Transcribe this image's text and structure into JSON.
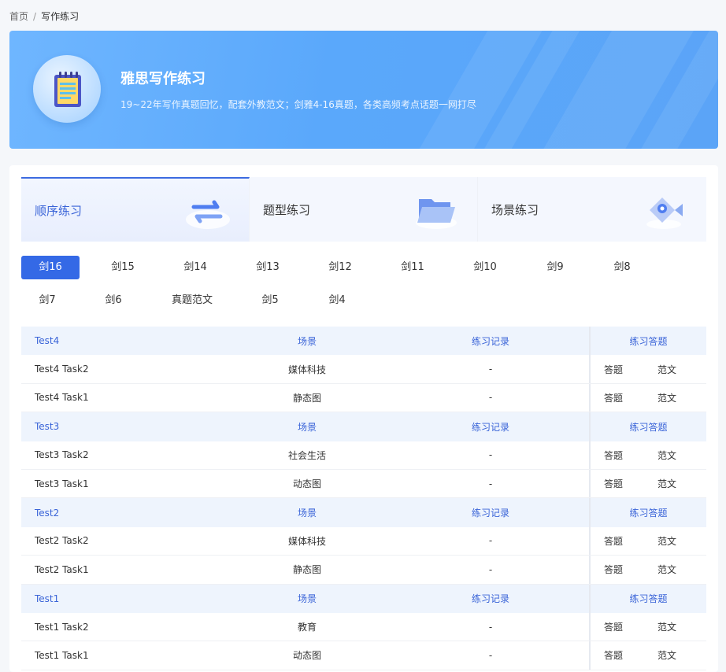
{
  "breadcrumb": {
    "home": "首页",
    "separator": "/",
    "current": "写作练习"
  },
  "banner": {
    "title": "雅思写作练习",
    "subtitle": "19~22年写作真题回忆，配套外教范文；剑雅4-16真题，各类高频考点话题一网打尽",
    "icon": "notepad-icon"
  },
  "mode_tabs": [
    {
      "label": "顺序练习",
      "icon": "swap-arrows-icon",
      "active": true
    },
    {
      "label": "题型练习",
      "icon": "folder-icon",
      "active": false
    },
    {
      "label": "场景练习",
      "icon": "location-fish-icon",
      "active": false
    }
  ],
  "book_tabs": [
    "剑16",
    "剑15",
    "剑14",
    "剑13",
    "剑12",
    "剑11",
    "剑10",
    "剑9",
    "剑8",
    "剑7",
    "剑6",
    "真题范文",
    "剑5",
    "剑4"
  ],
  "active_book": "剑16",
  "table": {
    "headers": {
      "scene": "场景",
      "record": "练习记录",
      "actions": "练习答题"
    },
    "action_labels": {
      "answer": "答题",
      "model": "范文"
    },
    "groups": [
      {
        "name": "Test4",
        "rows": [
          {
            "task": "Test4 Task2",
            "scene": "媒体科技",
            "record": "-"
          },
          {
            "task": "Test4 Task1",
            "scene": "静态图",
            "record": "-"
          }
        ]
      },
      {
        "name": "Test3",
        "rows": [
          {
            "task": "Test3 Task2",
            "scene": "社会生活",
            "record": "-"
          },
          {
            "task": "Test3 Task1",
            "scene": "动态图",
            "record": "-"
          }
        ]
      },
      {
        "name": "Test2",
        "rows": [
          {
            "task": "Test2 Task2",
            "scene": "媒体科技",
            "record": "-"
          },
          {
            "task": "Test2 Task1",
            "scene": "静态图",
            "record": "-"
          }
        ]
      },
      {
        "name": "Test1",
        "rows": [
          {
            "task": "Test1 Task2",
            "scene": "教育",
            "record": "-"
          },
          {
            "task": "Test1 Task1",
            "scene": "动态图",
            "record": "-"
          }
        ]
      }
    ]
  },
  "colors": {
    "accent": "#3469e6",
    "header_text": "#3a64d8",
    "banner": "#5ba4f7"
  }
}
